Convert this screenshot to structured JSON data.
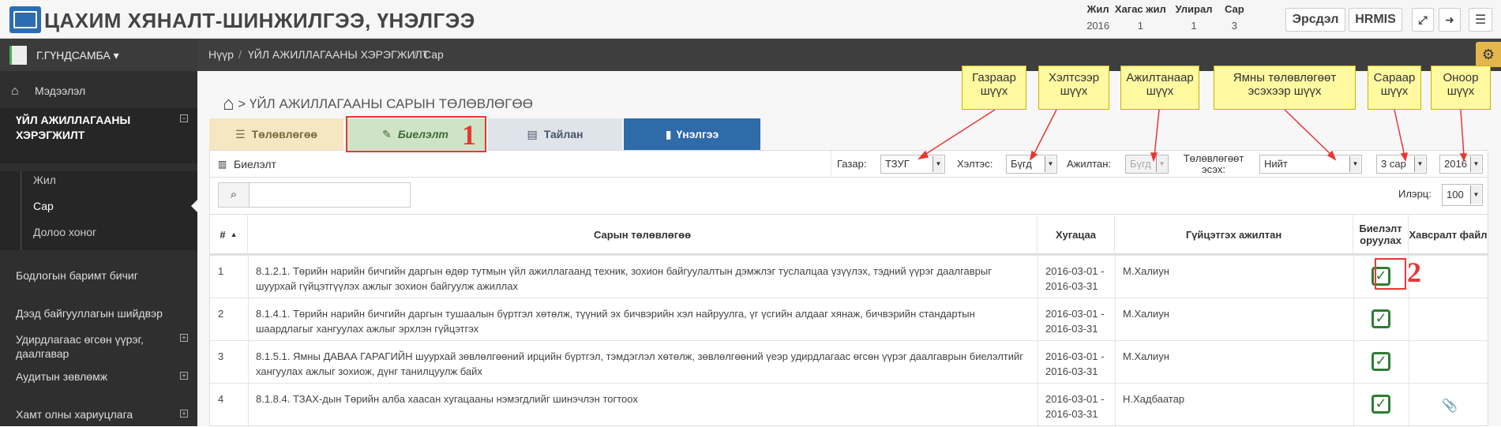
{
  "app": {
    "title": "ЦАХИМ ХЯНАЛТ-ШИНЖИЛГЭЭ, ҮНЭЛГЭЭ"
  },
  "period": {
    "headers": [
      "Жил",
      "Хагас жил",
      "Улирал",
      "Сар"
    ],
    "values": [
      "2016",
      "1",
      "1",
      "3"
    ]
  },
  "top_buttons": {
    "risk": "Эрсдэл",
    "hrmis": "HRMIS"
  },
  "user": {
    "name": "Г.ГҮНДСАМБА ▾"
  },
  "sidebar": {
    "info": "Мэдээлэл",
    "section": "ҮЙЛ АЖИЛЛАГААНЫ ХЭРЭГЖИЛТ",
    "sub": [
      "Жил",
      "Сар",
      "Долоо хоног"
    ],
    "items": [
      "Бодлогын баримт бичиг",
      "Дээд байгууллагын шийдвэр",
      "Удирдлагаас өгсөн үүрэг, даалгавар",
      "Аудитын зөвлөмж",
      "Хамт олны хариуцлага"
    ]
  },
  "breadcrumb": [
    "Нүүр",
    "ҮЙЛ АЖИЛЛАГААНЫ ХЭРЭГЖИЛТ",
    "Сар"
  ],
  "page": {
    "title": "> ҮЙЛ АЖИЛЛАГААНЫ САРЫН ТӨЛӨВЛӨГӨӨ"
  },
  "tabs": [
    "Төлөвлөгөө",
    "Биелэлт",
    "Тайлан",
    "Үнэлгээ"
  ],
  "panel": {
    "title": "Биелэлт",
    "rows_label": "Илэрц:",
    "rows_value": "100"
  },
  "filters": [
    {
      "label": "Газар:",
      "value": "ТЗУГ"
    },
    {
      "label": "Хэлтэс:",
      "value": "Бүгд"
    },
    {
      "label": "Ажилтан:",
      "value": "Бүгд"
    },
    {
      "label": "Төлөвлөгөөт эсэх:",
      "value": "Нийт"
    },
    {
      "label": "",
      "value": "3 сар"
    },
    {
      "label": "",
      "value": "2016"
    }
  ],
  "callouts": [
    "Газраар шүүх",
    "Хэлтсээр шүүх",
    "Ажилтанаар шүүх",
    "Ямны төлөвлөгөөт эсэхээр шүүх",
    "Сараар шүүх",
    "Оноор шүүх"
  ],
  "markers": [
    "1",
    "2"
  ],
  "table": {
    "headers": [
      "#",
      "Сарын төлөвлөгөө",
      "Хугацаа",
      "Гүйцэтгэх ажилтан",
      "Биелэлт оруулах",
      "Хавсралт файл"
    ],
    "rows": [
      {
        "n": "1",
        "plan": "8.1.2.1. Төрийн нарийн бичгийн даргын өдөр тутмын үйл ажиллагаанд техник, зохион байгуулалтын дэмжлэг туслалцаа үзүүлэх, тэдний үүрэг даалгаврыг шуурхай гүйцэтгүүлэх ажлыг зохион байгуулж ажиллах",
        "from": "2016-03-01 -",
        "to": "2016-03-31",
        "who": "М.Халиун"
      },
      {
        "n": "2",
        "plan": "8.1.4.1. Төрийн нарийн бичгийн даргын тушаалын бүртгэл хөтөлж, түүний эх бичвэрийн хэл найруулга, үг үсгийн алдааг хянаж, бичвэрийн стандартын шаардлагыг хангуулах ажлыг эрхлэн гүйцэтгэх",
        "from": "2016-03-01 -",
        "to": "2016-03-31",
        "who": "М.Халиун"
      },
      {
        "n": "3",
        "plan": "8.1.5.1. Ямны ДАВАА ГАРАГИЙН шуурхай зөвлөлгөөний ирцийн бүртгэл, тэмдэглэл хөтөлж, зөвлөлгөөний үеэр удирдлагаас өгсөн үүрэг даалгаврын биелэлтийг хангуулах ажлыг зохиож, дүнг танилцуулж байх",
        "from": "2016-03-01 -",
        "to": "2016-03-31",
        "who": "М.Халиун"
      },
      {
        "n": "4",
        "plan": "8.1.8.4. ТЗАХ-дын Төрийн алба хаасан хугацааны нэмэгдлийг шинэчлэн тогтоох",
        "from": "2016-03-01 -",
        "to": "2016-03-31",
        "who": "Н.Хадбаатар"
      }
    ]
  },
  "colors": {
    "accent": "#2a6db4",
    "sidebar": "#2f2f2f",
    "tab_plan": "#f5e7c2",
    "tab_exec": "#cfe4c6",
    "tab_report": "#dfe3ea",
    "tab_eval": "#2f6aa9",
    "check": "#2e7d32",
    "marker": "#e53935"
  }
}
